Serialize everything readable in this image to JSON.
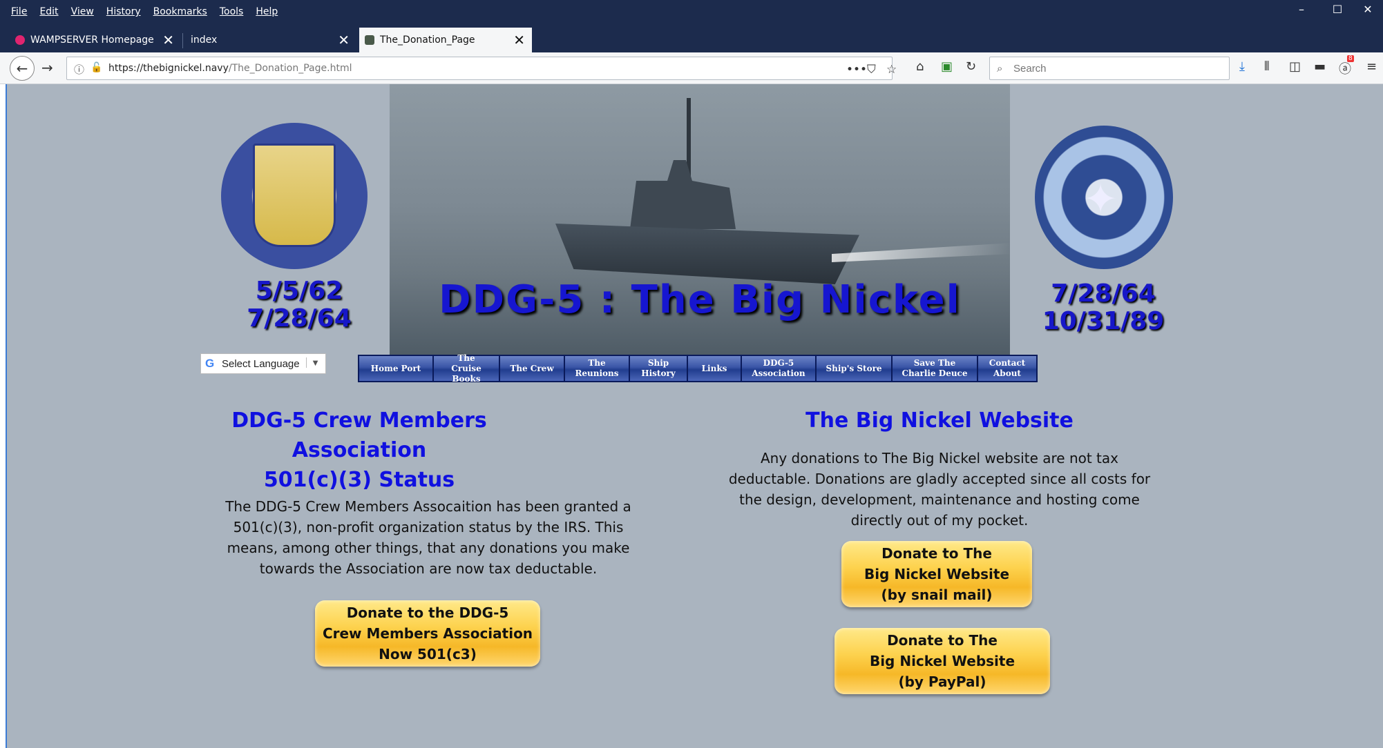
{
  "browser": {
    "menu": [
      "File",
      "Edit",
      "View",
      "History",
      "Bookmarks",
      "Tools",
      "Help"
    ],
    "tabs": [
      {
        "title": "WAMPSERVER Homepage",
        "active": false
      },
      {
        "title": "index",
        "active": false
      },
      {
        "title": "The_Donation_Page",
        "active": true
      }
    ],
    "url_domain": "https://thebignickel.navy",
    "url_path": "/The_Donation_Page.html",
    "search_placeholder": "Search",
    "badge_count": "8"
  },
  "page": {
    "left_dates": [
      "5/5/62",
      "7/28/64"
    ],
    "right_dates": [
      "7/28/64",
      "10/31/89"
    ],
    "banner_title": "DDG-5 : The Big Nickel",
    "translate_label": "Select Language",
    "nav": [
      "Home Port",
      "The\nCruise Books",
      "The Crew",
      "The\nReunions",
      "Ship\nHistory",
      "Links",
      "DDG-5\nAssociation",
      "Ship's Store",
      "Save The\nCharlie Deuce",
      "Contact\nAbout"
    ],
    "left": {
      "heading": "DDG-5 Crew Members\nAssociation\n501(c)(3) Status",
      "text": "The DDG-5 Crew Members Assocaition has been granted a 501(c)(3), non-profit organization status by the IRS.  This means, among other things, that any donations you make towards the Association are now tax deductable.",
      "button": "Donate to the DDG-5\nCrew Members Association\nNow 501(c3)"
    },
    "right": {
      "heading": "The Big Nickel Website",
      "text": "Any donations to The Big Nickel website are not tax deductable.  Donations are gladly accepted since all costs for the design, development, maintenance and hosting come directly out of my pocket.",
      "button_mail": "Donate to The\nBig Nickel Website\n(by snail mail)",
      "button_paypal": "Donate to The\nBig Nickel Website\n(by PayPal)"
    }
  }
}
